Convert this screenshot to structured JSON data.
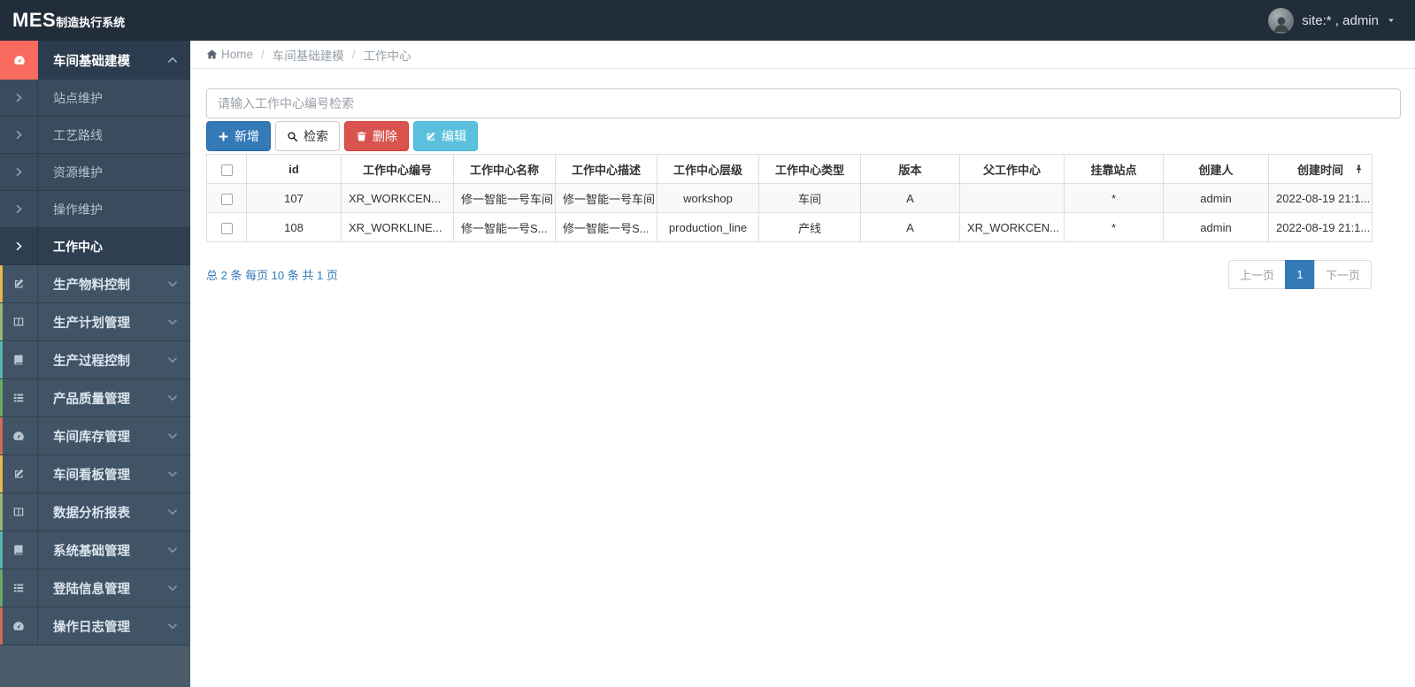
{
  "topbar": {
    "logo_mes": "MES",
    "logo_rest": "制造执行系统",
    "user_label": "site:* , admin",
    "avatar_icon": "person"
  },
  "sidebar": {
    "active_parent": {
      "label": "车间基础建模",
      "icon": "gauge",
      "chevron": "chevron-up"
    },
    "submenu": [
      {
        "label": "站点维护",
        "active": false
      },
      {
        "label": "工艺路线",
        "active": false
      },
      {
        "label": "资源维护",
        "active": false
      },
      {
        "label": "操作维护",
        "active": false
      },
      {
        "label": "工作中心",
        "active": true
      }
    ],
    "items": [
      {
        "label": "生产物料控制",
        "icon": "edit",
        "strip": "#e8b64c"
      },
      {
        "label": "生产计划管理",
        "icon": "columns",
        "strip": "#9db86e"
      },
      {
        "label": "生产过程控制",
        "icon": "book",
        "strip": "#55b5ad"
      },
      {
        "label": "产品质量管理",
        "icon": "list",
        "strip": "#69a969"
      },
      {
        "label": "车间库存管理",
        "icon": "gauge",
        "strip": "#d26a5c"
      },
      {
        "label": "车间看板管理",
        "icon": "edit",
        "strip": "#e8b64c"
      },
      {
        "label": "数据分析报表",
        "icon": "columns",
        "strip": "#9db86e"
      },
      {
        "label": "系统基础管理",
        "icon": "book",
        "strip": "#55b5ad"
      },
      {
        "label": "登陆信息管理",
        "icon": "list",
        "strip": "#69a969"
      },
      {
        "label": "操作日志管理",
        "icon": "gauge",
        "strip": "#d26a5c"
      }
    ]
  },
  "breadcrumb": {
    "items": [
      "Home",
      "车间基础建模",
      "工作中心"
    ],
    "home_icon": "home"
  },
  "search": {
    "placeholder": "请输入工作中心编号检索",
    "value": ""
  },
  "toolbar": {
    "add_label": "新增",
    "add_icon": "plus",
    "search_label": "检索",
    "search_icon": "search",
    "delete_label": "删除",
    "delete_icon": "trash",
    "edit_label": "编辑",
    "edit_icon": "edit"
  },
  "table": {
    "columns": [
      "id",
      "工作中心编号",
      "工作中心名称",
      "工作中心描述",
      "工作中心层级",
      "工作中心类型",
      "版本",
      "父工作中心",
      "挂靠站点",
      "创建人",
      "创建时间"
    ],
    "pin_icon_column": "创建时间",
    "rows": [
      [
        "107",
        "XR_WORKCEN...",
        "修一智能一号车间",
        "修一智能一号车间",
        "workshop",
        "车间",
        "A",
        "",
        "*",
        "admin",
        "2022-08-19 21:1..."
      ],
      [
        "108",
        "XR_WORKLINE...",
        "修一智能一号S...",
        "修一智能一号S...",
        "production_line",
        "产线",
        "A",
        "XR_WORKCEN...",
        "*",
        "admin",
        "2022-08-19 21:1..."
      ]
    ]
  },
  "footer": {
    "summary": "总 2 条 每页 10 条 共 1 页",
    "pagination": {
      "prev": "上一页",
      "current": "1",
      "next": "下一页"
    }
  },
  "colors": {
    "topbar_bg": "#222d3a",
    "sidebar_bg": "#4a5c6a",
    "active_icon_block": "#f96b5f",
    "primary": "#337ab7",
    "danger": "#d9534f",
    "info": "#5bc0de",
    "link": "#337ab7"
  }
}
